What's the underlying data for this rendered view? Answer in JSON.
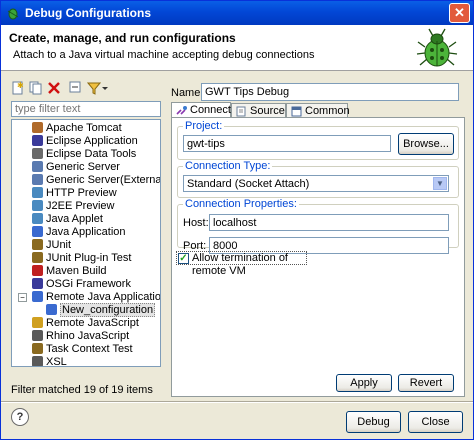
{
  "window": {
    "title": "Debug Configurations"
  },
  "header": {
    "title": "Create, manage, and run configurations",
    "description": "Attach to a Java virtual machine accepting debug connections"
  },
  "filter": {
    "placeholder": "type filter text"
  },
  "tree": {
    "items": [
      {
        "label": "Apache Tomcat",
        "icon": "tomcat-icon"
      },
      {
        "label": "Eclipse Application",
        "icon": "eclipse-icon"
      },
      {
        "label": "Eclipse Data Tools",
        "icon": "data-tools-icon"
      },
      {
        "label": "Generic Server",
        "icon": "server-icon"
      },
      {
        "label": "Generic Server(External Launch",
        "icon": "server-icon"
      },
      {
        "label": "HTTP Preview",
        "icon": "http-preview-icon"
      },
      {
        "label": "J2EE Preview",
        "icon": "j2ee-preview-icon"
      },
      {
        "label": "Java Applet",
        "icon": "applet-icon"
      },
      {
        "label": "Java Application",
        "icon": "java-app-icon"
      },
      {
        "label": "JUnit",
        "icon": "junit-icon"
      },
      {
        "label": "JUnit Plug-in Test",
        "icon": "junit-plugin-icon"
      },
      {
        "label": "Maven Build",
        "icon": "maven-icon"
      },
      {
        "label": "OSGi Framework",
        "icon": "osgi-icon"
      },
      {
        "label": "Remote Java Application",
        "icon": "remote-java-icon"
      },
      {
        "label": "New_configuration",
        "icon": "config-icon"
      },
      {
        "label": "Remote JavaScript",
        "icon": "remote-js-icon"
      },
      {
        "label": "Rhino JavaScript",
        "icon": "rhino-icon"
      },
      {
        "label": "Task Context Test",
        "icon": "task-test-icon"
      },
      {
        "label": "XSL",
        "icon": "xsl-icon"
      }
    ],
    "status": "Filter matched 19 of 19 items"
  },
  "config": {
    "name_label": "Name:",
    "name_value": "GWT Tips Debug",
    "tabs": [
      {
        "label": "Connect",
        "icon": "connect-icon"
      },
      {
        "label": "Source",
        "icon": "source-icon"
      },
      {
        "label": "Common",
        "icon": "common-icon"
      }
    ],
    "project_group": "Project:",
    "project_value": "gwt-tips",
    "browse_label": "Browse...",
    "connection_type_group": "Connection Type:",
    "connection_type_value": "Standard (Socket Attach)",
    "connection_props_group": "Connection Properties:",
    "host_label": "Host:",
    "host_value": "localhost",
    "port_label": "Port:",
    "port_value": "8000",
    "allow_termination_label": "Allow termination of remote VM",
    "allow_termination_checked": true,
    "apply_label": "Apply",
    "revert_label": "Revert"
  },
  "footer": {
    "debug_label": "Debug",
    "close_label": "Close"
  },
  "colors": {
    "title_bar": "#0247d6",
    "group_label": "#0046d5",
    "selection": "#e4e4e4"
  }
}
